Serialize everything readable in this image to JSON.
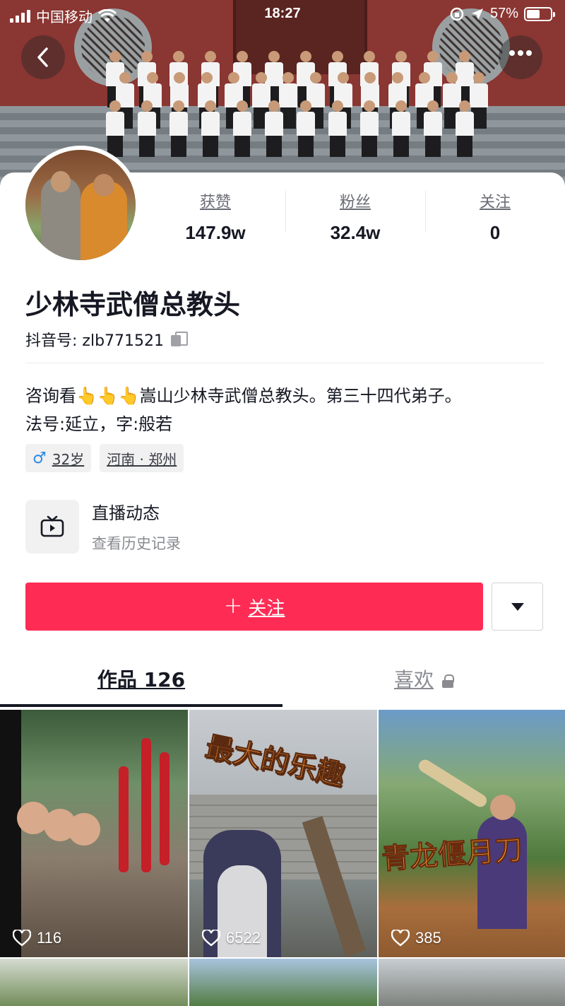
{
  "status_bar": {
    "carrier": "中国移动",
    "time": "18:27",
    "battery": "57%",
    "battery_level": 0.57
  },
  "profile": {
    "name": "少林寺武僧总教头",
    "douyin_id_label": "抖音号: ",
    "douyin_id": "zlb771521",
    "stats": [
      {
        "label": "获赞",
        "value": "147.9w"
      },
      {
        "label": "粉丝",
        "value": "32.4w"
      },
      {
        "label": "关注",
        "value": "0"
      }
    ],
    "bio_line1": "咨询看👆👆👆嵩山少林寺武僧总教头。第三十四代弟子。",
    "bio_line2": "法号:延立，字:般若",
    "tags": {
      "gender_icon": "♂",
      "age": "32岁",
      "location": "河南 · 郑州"
    }
  },
  "live": {
    "title": "直播动态",
    "subtitle": "查看历史记录"
  },
  "actions": {
    "follow_plus": "+",
    "follow_label": "关注"
  },
  "tabs": {
    "works_label": "作品 126",
    "likes_label": "喜欢"
  },
  "videos": [
    {
      "likes": "116",
      "caption": ""
    },
    {
      "likes": "6522",
      "caption": "最大的乐趣"
    },
    {
      "likes": "385",
      "caption": "青龙偃月刀"
    }
  ],
  "icons": {
    "back": "chevron-left-icon",
    "more": "more-dots-icon",
    "copy": "copy-icon",
    "live": "tv-icon",
    "dropdown": "triangle-down-icon",
    "lock": "lock-icon",
    "heart": "heart-icon"
  },
  "colors": {
    "accent": "#fe2c55",
    "text_primary": "#161823",
    "text_secondary": "#8a8b91",
    "male": "#2b89e6"
  }
}
